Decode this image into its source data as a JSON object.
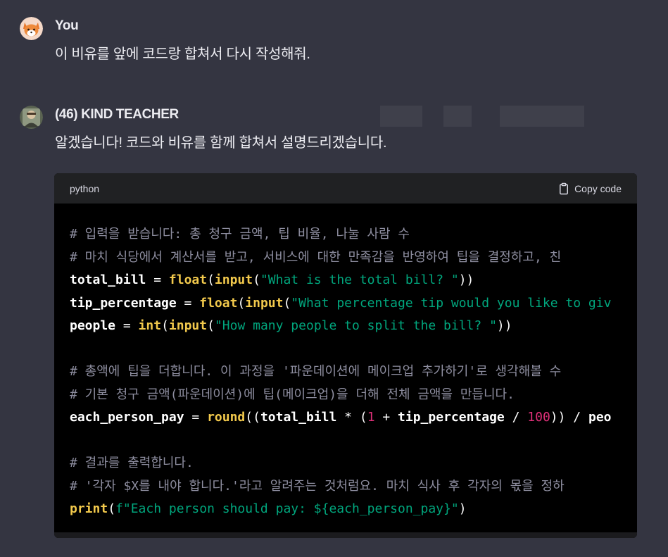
{
  "user_message": {
    "author": "You",
    "text": "이 비유를 앞에 코드랑 합쳐서 다시 작성해줘."
  },
  "assistant_message": {
    "author": "(46) KIND TEACHER",
    "text": "알겠습니다! 코드와 비유를 함께 합쳐서 설명드리겠습니다."
  },
  "code_block": {
    "language": "python",
    "copy_label": "Copy code",
    "lines": [
      "# 입력을 받습니다: 총 청구 금액, 팁 비율, 나눌 사람 수",
      "# 마치 식당에서 계산서를 받고, 서비스에 대한 만족감을 반영하여 팁을 결정하고, 친",
      "total_bill = float(input(\"What is the total bill? \"))",
      "tip_percentage = float(input(\"What percentage tip would you like to giv",
      "people = int(input(\"How many people to split the bill? \"))",
      "",
      "# 총액에 팁을 더합니다. 이 과정을 '파운데이션에 메이크업 추가하기'로 생각해볼 수",
      "# 기본 청구 금액(파운데이션)에 팁(메이크업)을 더해 전체 금액을 만듭니다.",
      "each_person_pay = round((total_bill * (1 + tip_percentage / 100)) / peo",
      "",
      "# 결과를 출력합니다.",
      "# '각자 $X를 내야 합니다.'라고 알려주는 것처럼요. 마치 식사 후 각자의 몫을 정하",
      "print(f\"Each person should pay: ${each_person_pay}\")"
    ]
  },
  "colors": {
    "background": "#343541",
    "code_bg": "#000000",
    "code_header_bg": "#202123",
    "comment": "#8e8ea0",
    "builtin": "#f2c94c",
    "string": "#00a67d",
    "number": "#df3079"
  },
  "icons": {
    "copy": "clipboard-icon",
    "user_avatar": "fox-avatar",
    "assistant_avatar": "teacher-avatar"
  }
}
